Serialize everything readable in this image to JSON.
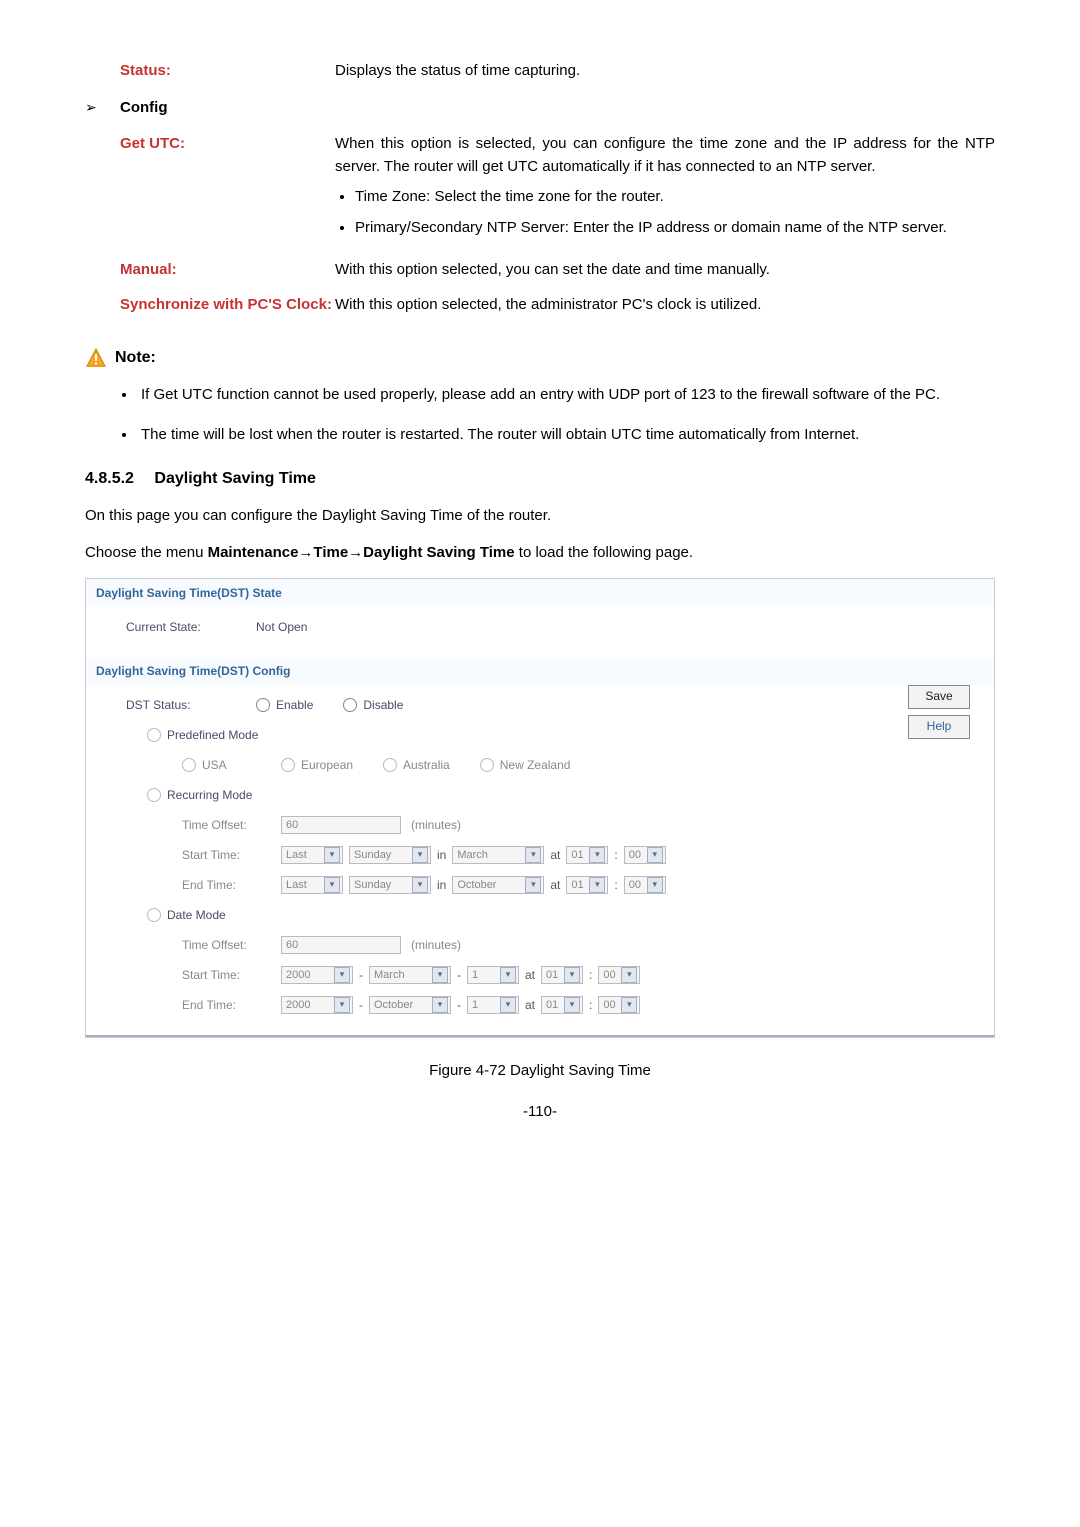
{
  "defs": {
    "status_term": "Status:",
    "status_desc": "Displays the status of time capturing.",
    "config_label": "Config",
    "getutc_term": "Get UTC:",
    "getutc_desc": "When this option is selected, you can configure the time zone and the IP address for the NTP server. The router will get UTC automatically if it has connected to an NTP server.",
    "getutc_b1": "Time Zone: Select the time zone for the router.",
    "getutc_b2": "Primary/Secondary NTP Server: Enter the IP address or domain name of the NTP server.",
    "manual_term": "Manual:",
    "manual_desc": "With this option selected, you can set the date and time manually.",
    "sync_term": "Synchronize with PC'S Clock:",
    "sync_desc": "With this option selected, the administrator PC's clock is utilized."
  },
  "note": {
    "label": "Note:",
    "items": [
      "If Get UTC function cannot be used properly, please add an entry with UDP port of 123 to the firewall software of the PC.",
      "The time will be lost when the router is restarted. The router will obtain UTC time automatically from Internet."
    ]
  },
  "section": {
    "num": "4.8.5.2",
    "title": "Daylight Saving Time",
    "intro": "On this page you can configure the Daylight Saving Time of the router.",
    "nav_prefix": "Choose the menu ",
    "nav_path": "Maintenance→Time→Daylight Saving Time",
    "nav_suffix": " to load the following page."
  },
  "dst": {
    "state_title": "Daylight Saving Time(DST) State",
    "current_state_label": "Current State:",
    "current_state_value": "Not Open",
    "config_title": "Daylight Saving Time(DST) Config",
    "dst_status_label": "DST Status:",
    "enable": "Enable",
    "disable": "Disable",
    "predefined_mode": "Predefined Mode",
    "regions": {
      "usa": "USA",
      "european": "European",
      "australia": "Australia",
      "newzealand": "New Zealand"
    },
    "recurring_mode": "Recurring Mode",
    "time_offset_label": "Time Offset:",
    "time_offset_value": "60",
    "minutes": "(minutes)",
    "start_time_label": "Start Time:",
    "end_time_label": "End Time:",
    "last": "Last",
    "sunday": "Sunday",
    "in_word": "in",
    "march": "March",
    "october": "October",
    "at_word": "at",
    "h01": "01",
    "m00": "00",
    "date_mode": "Date Mode",
    "year": "2000",
    "day1": "1",
    "dash": "-",
    "save": "Save",
    "help": "Help"
  },
  "figure_caption": "Figure 4-72 Daylight Saving Time",
  "page_number": "-110-"
}
